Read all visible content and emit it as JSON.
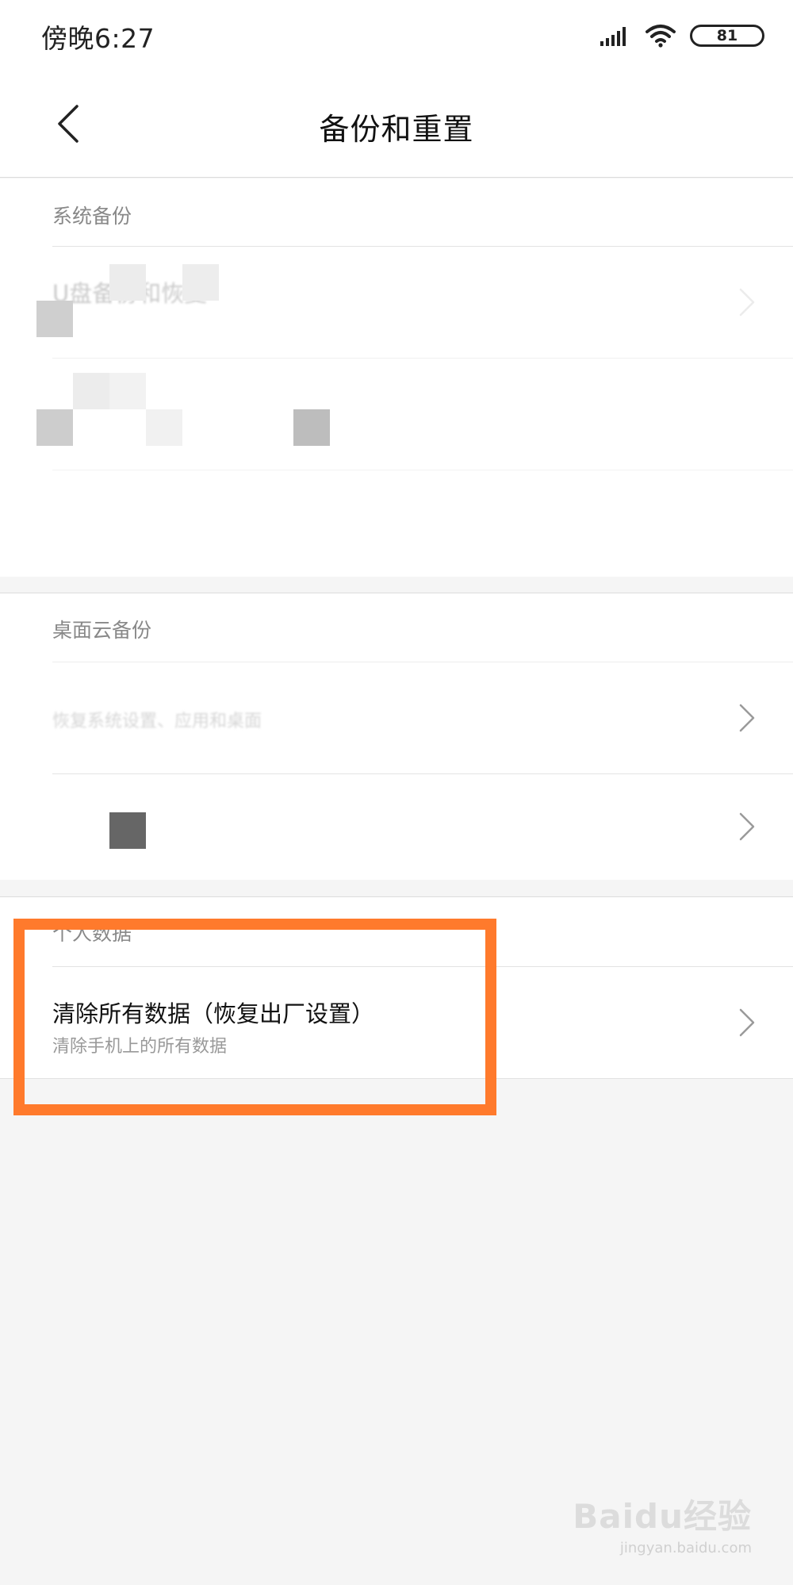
{
  "status_bar": {
    "time": "傍晚6:27",
    "battery": "81",
    "icons": [
      "signal-icon",
      "wifi-icon",
      "battery-icon"
    ]
  },
  "header": {
    "title": "备份和重置",
    "back_icon": "chevron-left-icon"
  },
  "sections": [
    {
      "header": "系统备份",
      "items": [
        {
          "title": "U盘备份和恢复",
          "subtitle": ""
        },
        {
          "title": "",
          "subtitle": ""
        }
      ]
    },
    {
      "header": "桌面云备份",
      "items": [
        {
          "title": "",
          "subtitle": "恢复系统设置、应用和桌面"
        },
        {
          "title": "",
          "subtitle": ""
        }
      ]
    },
    {
      "header": "个人数据",
      "items": [
        {
          "title": "清除所有数据（恢复出厂设置）",
          "subtitle": "清除手机上的所有数据"
        }
      ]
    }
  ],
  "watermark": {
    "logo": "Baidu经验",
    "url": "jingyan.baidu.com"
  },
  "colors": {
    "highlight": "#ff7a2c",
    "background": "#f5f5f5",
    "card": "#ffffff",
    "section_header": "#888888"
  }
}
